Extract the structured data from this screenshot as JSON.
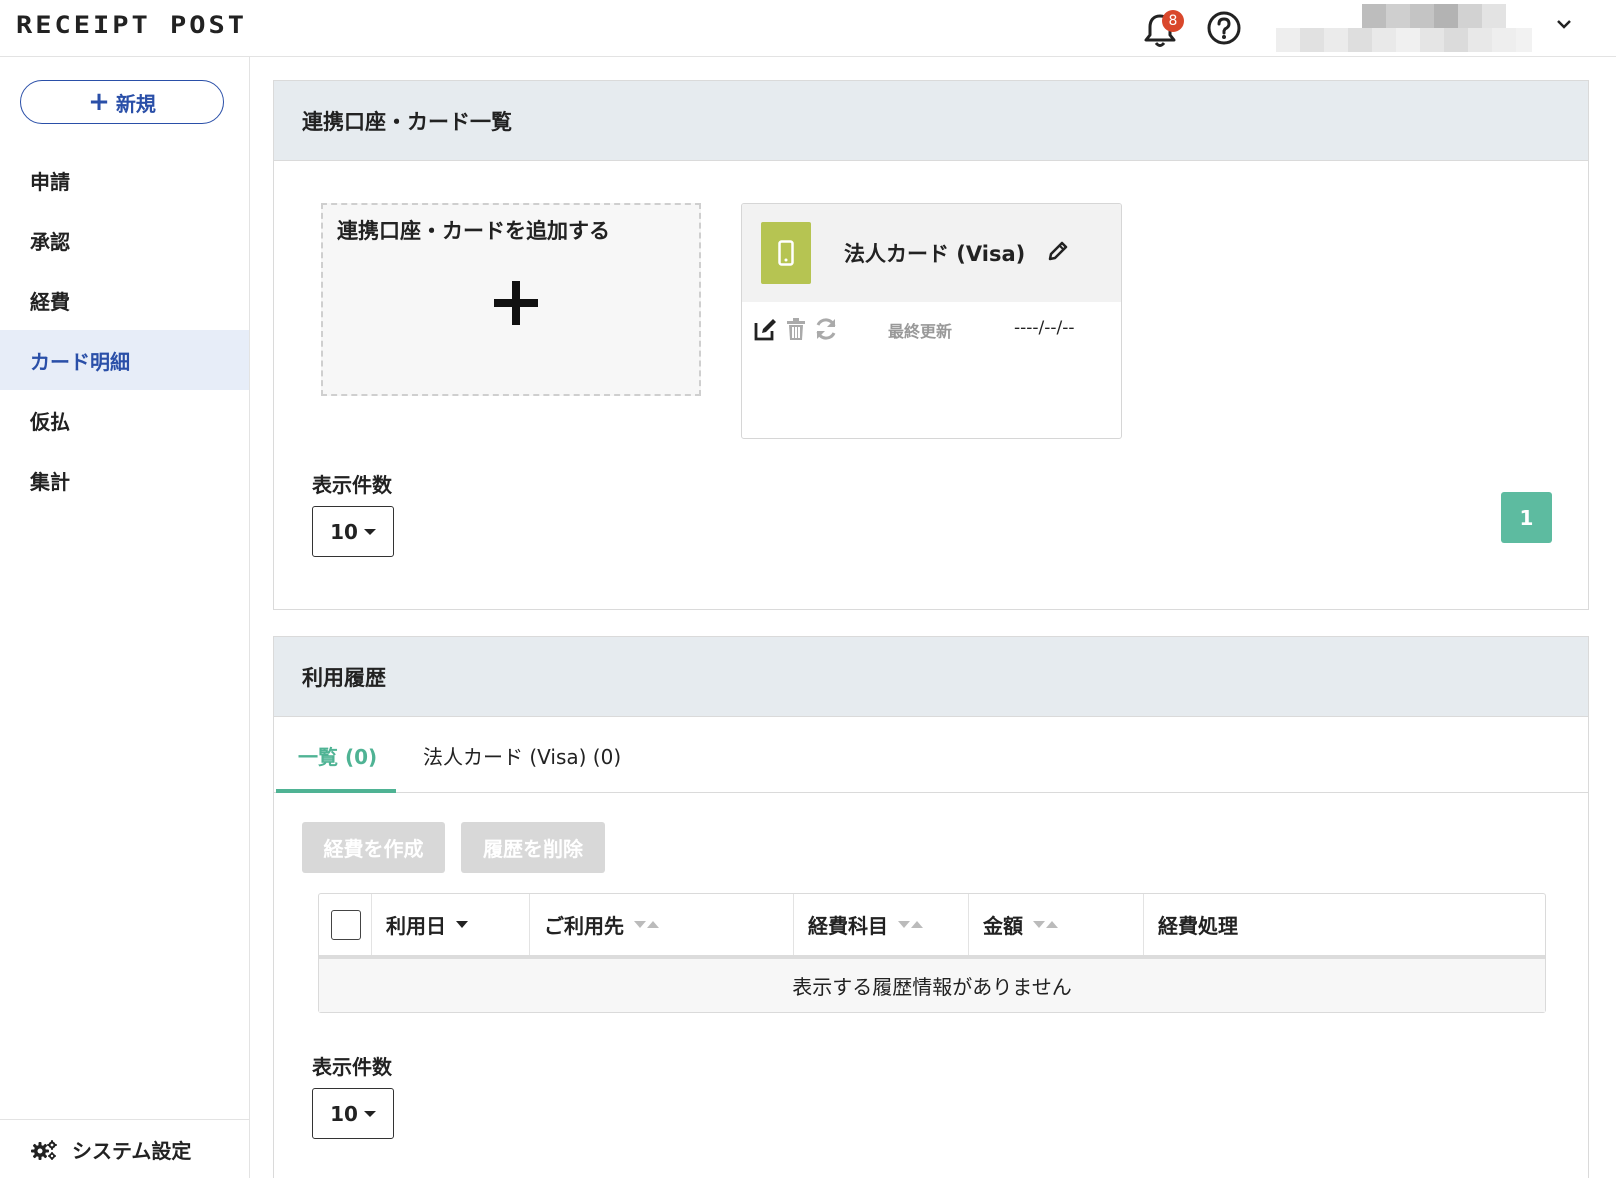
{
  "header": {
    "logo": "RECEIPT POST",
    "notification_count": "8"
  },
  "sidebar": {
    "new_label": "新規",
    "items": [
      {
        "label": "申請"
      },
      {
        "label": "承認"
      },
      {
        "label": "経費"
      },
      {
        "label": "カード明細",
        "active": true
      },
      {
        "label": "仮払"
      },
      {
        "label": "集計"
      }
    ],
    "settings_label": "システム設定"
  },
  "accounts_panel": {
    "title": "連携口座・カード一覧",
    "add_label": "連携口座・カードを追加する",
    "card": {
      "name": "法人カード (Visa)",
      "last_updated_label": "最終更新",
      "last_updated_value": "----/--/--",
      "icon_color": "#b6c452"
    },
    "per_page_label": "表示件数",
    "per_page_value": "10",
    "page": "1"
  },
  "history_panel": {
    "title": "利用履歴",
    "tabs": [
      {
        "label": "一覧 (0)",
        "active": true
      },
      {
        "label": "法人カード (Visa) (0)"
      }
    ],
    "create_expense_label": "経費を作成",
    "delete_history_label": "履歴を削除",
    "columns": [
      "利用日",
      "ご利用先",
      "経費科目",
      "金額",
      "経費処理"
    ],
    "empty_message": "表示する履歴情報がありません",
    "per_page_label": "表示件数",
    "per_page_value": "10"
  },
  "colors": {
    "accent_blue": "#2a4fa8",
    "accent_green": "#4fb394",
    "page_button": "#5dbba0",
    "badge": "#d9472b"
  }
}
